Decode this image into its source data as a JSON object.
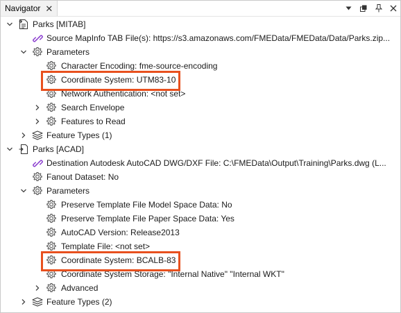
{
  "panel": {
    "title": "Navigator",
    "close_glyph": "✕",
    "controls": [
      "dropdown-icon",
      "float-icon",
      "pin-icon",
      "close-icon"
    ]
  },
  "tree": {
    "reader": {
      "label": "Parks [MITAB]",
      "icon": "reader-icon",
      "source": "Source MapInfo TAB File(s): https://s3.amazonaws.com/FMEData/FMEData/Data/Parks.zip...",
      "parameters_label": "Parameters",
      "params": {
        "char_encoding": "Character Encoding: fme-source-encoding",
        "coord_system": "Coordinate System: UTM83-10",
        "network_auth": "Network Authentication: <not set>",
        "search_envelope": "Search Envelope",
        "features_to_read": "Features to Read"
      },
      "feature_types": "Feature Types (1)"
    },
    "writer": {
      "label": "Parks [ACAD]",
      "icon": "writer-icon",
      "destination": "Destination Autodesk AutoCAD DWG/DXF File: C:\\FMEData\\Output\\Training\\Parks.dwg (L...",
      "fanout": "Fanout Dataset: No",
      "parameters_label": "Parameters",
      "params": {
        "model_space": "Preserve Template File Model Space Data: No",
        "paper_space": "Preserve Template File Paper Space Data: Yes",
        "acad_version": "AutoCAD Version: Release2013",
        "template_file": "Template File: <not set>",
        "coord_system": "Coordinate System: BCALB-83",
        "coord_storage": "Coordinate System Storage: \"Internal Native\" \"Internal WKT\"",
        "advanced": "Advanced"
      },
      "feature_types": "Feature Types (2)"
    }
  },
  "highlight_color": "#e8501e",
  "icon_color": "#5a5a5a",
  "link_icon_color": "#8a3ccf"
}
